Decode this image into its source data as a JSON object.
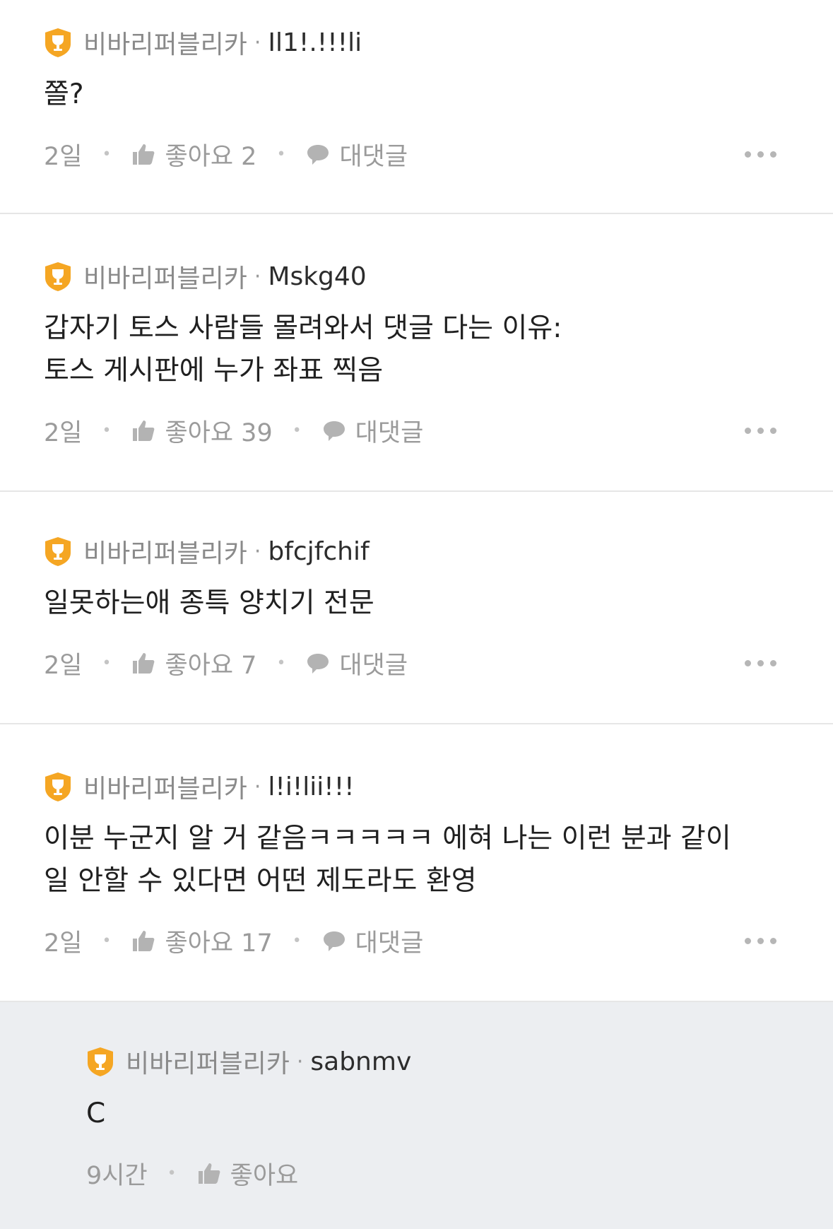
{
  "comments": [
    {
      "group": "비바리퍼블리카",
      "nick": "Il1!.!!!li",
      "body": "쫄?",
      "time": "2일",
      "like": "좋아요 2",
      "reply": "대댓글"
    },
    {
      "group": "비바리퍼블리카",
      "nick": "Mskg40",
      "body": "갑자기 토스 사람들 몰려와서 댓글 다는 이유:\n토스 게시판에 누가 좌표 찍음",
      "time": "2일",
      "like": "좋아요 39",
      "reply": "대댓글"
    },
    {
      "group": "비바리퍼블리카",
      "nick": "bfcjfchif",
      "body": "일못하는애 종특 양치기 전문",
      "time": "2일",
      "like": "좋아요 7",
      "reply": "대댓글"
    },
    {
      "group": "비바리퍼블리카",
      "nick": "l!i!lii!!!",
      "body": "이분 누군지 알 거 같음ㅋㅋㅋㅋㅋ 에혀 나는 이런 분과 같이\n일 안할 수 있다면 어떤 제도라도 환영",
      "time": "2일",
      "like": "좋아요 17",
      "reply": "대댓글"
    }
  ],
  "reply_comment": {
    "group": "비바리퍼블리카",
    "nick": "sabnmv",
    "body": "C",
    "time": "9시간",
    "like": "좋아요"
  },
  "colors": {
    "badge": "#f5a623",
    "reply_bg": "#eceef1"
  },
  "icons": [
    "trophy-badge-icon",
    "thumbs-up-icon",
    "speech-bubble-icon",
    "more-dots-icon"
  ]
}
